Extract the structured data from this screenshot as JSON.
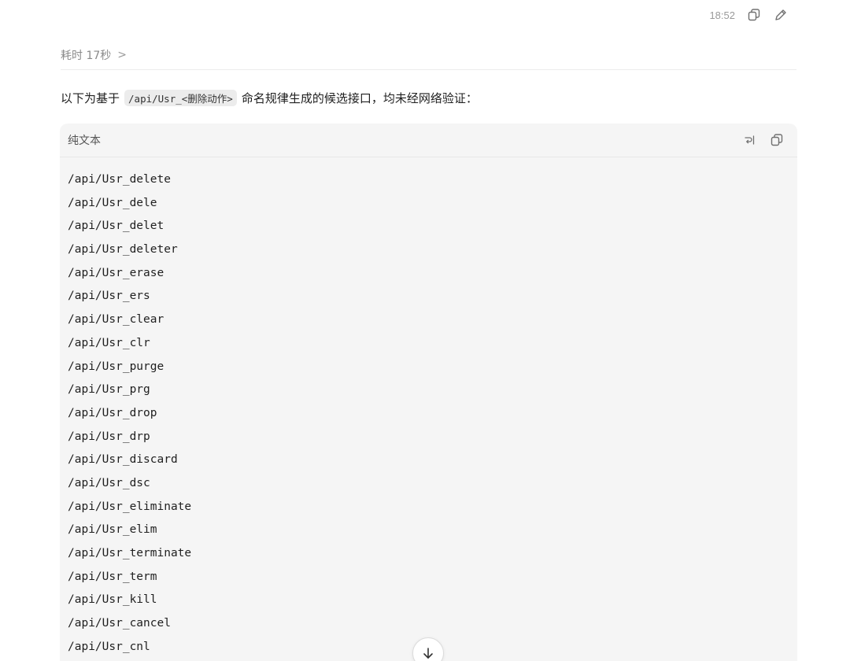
{
  "message_meta": {
    "time": "18:52",
    "copy_icon": "copy-icon",
    "edit_icon": "pencil-icon"
  },
  "thinking": {
    "label": "耗时 17秒",
    "chevron": ">"
  },
  "intro": {
    "before": "以下为基于",
    "code": "/api/Usr_<删除动作>",
    "after": "命名规律生成的候选接口，均未经网络验证："
  },
  "code_block": {
    "language": "纯文本",
    "wrap_icon": "wrap-lines-icon",
    "copy_icon": "copy-icon",
    "lines": [
      "/api/Usr_delete",
      "/api/Usr_dele",
      "/api/Usr_delet",
      "/api/Usr_deleter",
      "/api/Usr_erase",
      "/api/Usr_ers",
      "/api/Usr_clear",
      "/api/Usr_clr",
      "/api/Usr_purge",
      "/api/Usr_prg",
      "/api/Usr_drop",
      "/api/Usr_drp",
      "/api/Usr_discard",
      "/api/Usr_dsc",
      "/api/Usr_eliminate",
      "/api/Usr_elim",
      "/api/Usr_terminate",
      "/api/Usr_term",
      "/api/Usr_kill",
      "/api/Usr_cancel",
      "/api/Usr_cnl"
    ]
  },
  "scroll_button": {
    "icon": "arrow-down-icon"
  },
  "colors": {
    "code_bg": "#f5f5f5",
    "inline_code_bg": "#ececec",
    "muted_text": "#8a8a8a"
  }
}
